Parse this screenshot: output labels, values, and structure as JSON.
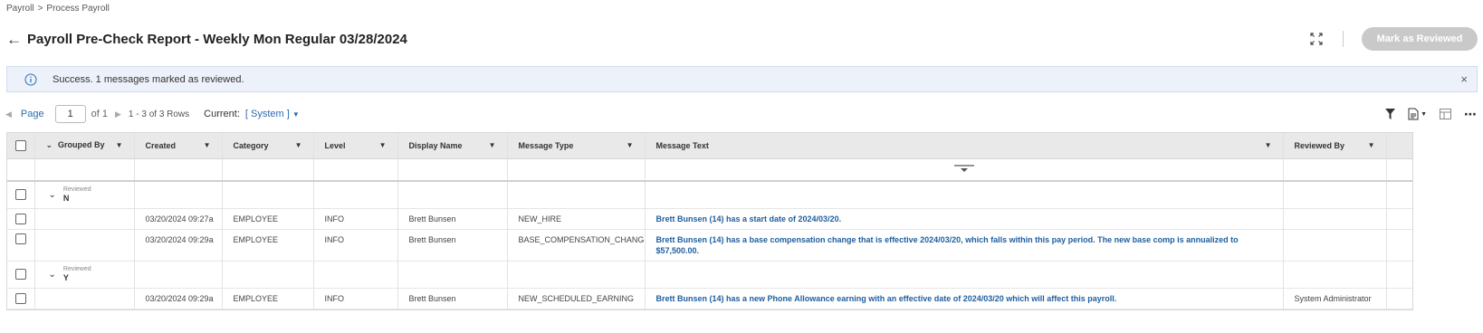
{
  "breadcrumb": {
    "root": "Payroll",
    "separator": ">",
    "current": "Process Payroll"
  },
  "header": {
    "title": "Payroll Pre-Check Report - Weekly Mon Regular 03/28/2024",
    "mark_button": "Mark as Reviewed"
  },
  "alert": {
    "message": "Success. 1 messages marked as reviewed.",
    "close": "×"
  },
  "pager": {
    "page_label": "Page",
    "page_value": "1",
    "of_label": "of 1",
    "rows_label": "1 - 3 of 3 Rows",
    "current_label": "Current:",
    "view_name": "[ System ]"
  },
  "columns": {
    "grouped_by": "Grouped By",
    "created": "Created",
    "category": "Category",
    "level": "Level",
    "display_name": "Display Name",
    "message_type": "Message Type",
    "message_text": "Message Text",
    "reviewed_by": "Reviewed By"
  },
  "groups": [
    {
      "label": "Reviewed",
      "value": "N",
      "rows": [
        {
          "created": "03/20/2024 09:27a",
          "category": "EMPLOYEE",
          "level": "INFO",
          "display_name": "Brett Bunsen",
          "message_type": "NEW_HIRE",
          "message_text": "Brett Bunsen (14) has a start date of 2024/03/20.",
          "reviewed_by": ""
        },
        {
          "created": "03/20/2024 09:29a",
          "category": "EMPLOYEE",
          "level": "INFO",
          "display_name": "Brett Bunsen",
          "message_type": "BASE_COMPENSATION_CHANGE",
          "message_text": "Brett Bunsen (14) has a base compensation change that is effective 2024/03/20, which falls within this pay period. The new base comp is annualized to $57,500.00.",
          "reviewed_by": ""
        }
      ]
    },
    {
      "label": "Reviewed",
      "value": "Y",
      "rows": [
        {
          "created": "03/20/2024 09:29a",
          "category": "EMPLOYEE",
          "level": "INFO",
          "display_name": "Brett Bunsen",
          "message_type": "NEW_SCHEDULED_EARNING",
          "message_text": "Brett Bunsen (14) has a new Phone Allowance earning with an effective date of 2024/03/20 which will affect this payroll.",
          "reviewed_by": "System Administrator"
        }
      ]
    }
  ],
  "icons": {
    "back": "left-arrow-icon",
    "expand": "expand-icon",
    "info": "info-circle-icon",
    "filter": "filter-icon",
    "export": "document-export-icon",
    "columns": "column-chooser-icon",
    "more": "more-horizontal-icon"
  },
  "colors": {
    "link": "#1f5e9e",
    "button_disabled": "#c9c9c9",
    "alert_bg": "#edf2fa",
    "header_bg": "#e9e9e9"
  }
}
